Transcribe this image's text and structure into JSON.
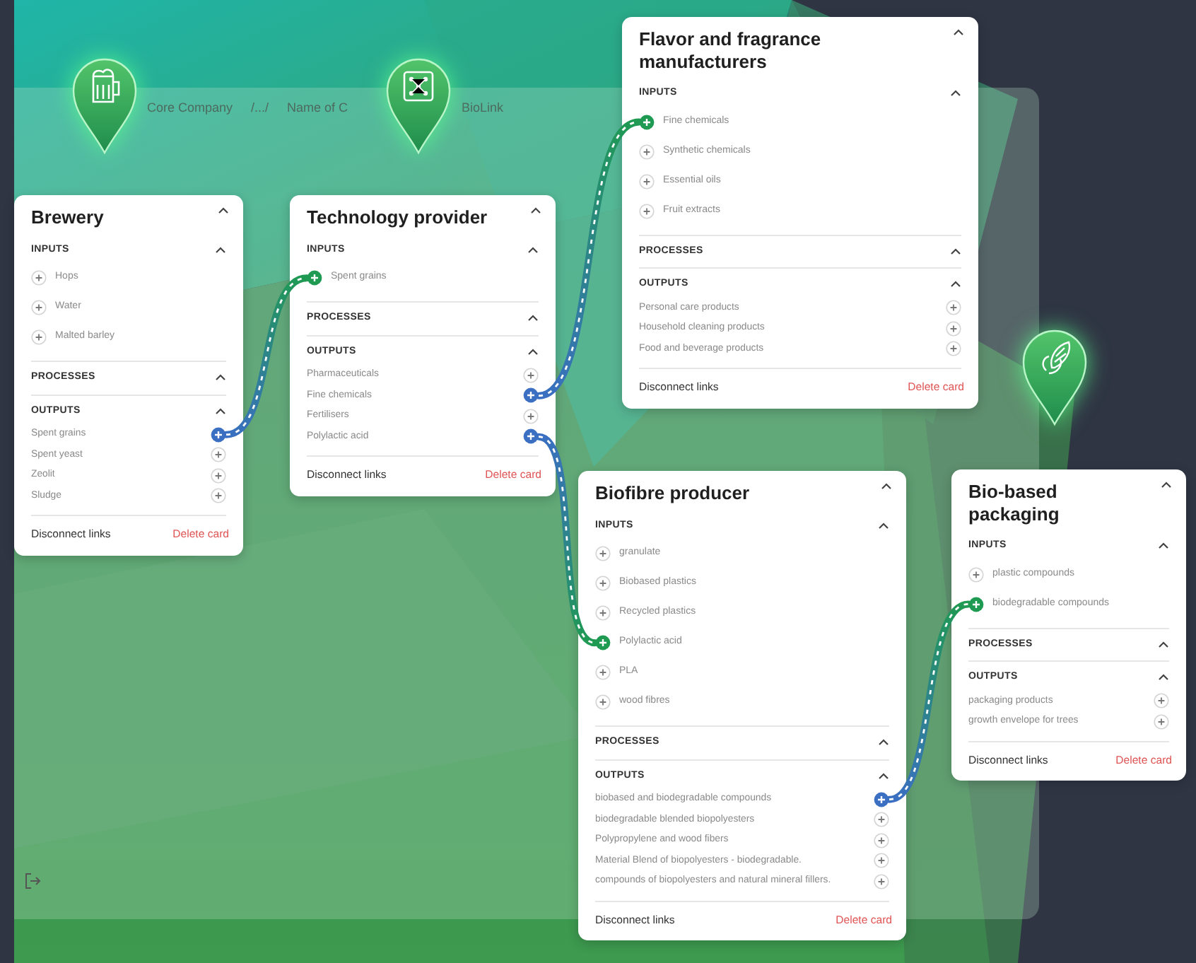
{
  "breadcrumb": [
    "Core Company",
    "/.../",
    "Name of C",
    "BioLink"
  ],
  "cards": [
    {
      "title": "Brewery",
      "expanded": true,
      "sections": [
        {
          "kind": "inputs",
          "title": "INPUTS",
          "expanded": true,
          "items": [
            {
              "label": "Hops",
              "linked": false
            },
            {
              "label": "Water",
              "linked": false
            },
            {
              "label": "Malted barley",
              "linked": false
            }
          ]
        },
        {
          "kind": "processes",
          "title": "PROCESSES",
          "expanded": true
        },
        {
          "kind": "outputs",
          "title": "OUTPUTS",
          "expanded": true,
          "items": [
            {
              "label": "Spent grains",
              "linked": true
            },
            {
              "label": "Spent yeast",
              "linked": false
            },
            {
              "label": "Zeolit",
              "linked": false
            },
            {
              "label": "Sludge",
              "linked": false
            }
          ]
        }
      ],
      "disconnect": "Disconnect links",
      "delete": "Delete card"
    },
    {
      "title": "Technology provider",
      "expanded": true,
      "sections": [
        {
          "kind": "inputs",
          "title": "INPUTS",
          "expanded": true,
          "items": [
            {
              "label": "Spent grains",
              "linked": true
            }
          ]
        },
        {
          "kind": "processes",
          "title": "PROCESSES",
          "expanded": true
        },
        {
          "kind": "outputs",
          "title": "OUTPUTS",
          "expanded": true,
          "items": [
            {
              "label": "Pharmaceuticals",
              "linked": false
            },
            {
              "label": "Fine chemicals",
              "linked": true
            },
            {
              "label": "Fertilisers",
              "linked": false
            },
            {
              "label": "Polylactic acid",
              "linked": true
            }
          ]
        }
      ],
      "disconnect": "Disconnect links",
      "delete": "Delete card"
    },
    {
      "title": "Flavor and fragrance manufacturers",
      "expanded": true,
      "sections": [
        {
          "kind": "inputs",
          "title": "INPUTS",
          "expanded": true,
          "items": [
            {
              "label": "Fine chemicals",
              "linked": true
            },
            {
              "label": "Synthetic chemicals",
              "linked": false
            },
            {
              "label": "Essential oils",
              "linked": false
            },
            {
              "label": "Fruit extracts",
              "linked": false
            }
          ]
        },
        {
          "kind": "processes",
          "title": "PROCESSES",
          "expanded": true
        },
        {
          "kind": "outputs",
          "title": "OUTPUTS",
          "expanded": true,
          "items": [
            {
              "label": "Personal care products",
              "linked": false
            },
            {
              "label": "Household cleaning products",
              "linked": false
            },
            {
              "label": "Food and beverage products",
              "linked": false
            }
          ]
        }
      ],
      "disconnect": "Disconnect links",
      "delete": "Delete card"
    },
    {
      "title": "Biofibre producer",
      "expanded": true,
      "sections": [
        {
          "kind": "inputs",
          "title": "INPUTS",
          "expanded": true,
          "items": [
            {
              "label": "granulate",
              "linked": false
            },
            {
              "label": "Biobased plastics",
              "linked": false
            },
            {
              "label": "Recycled plastics",
              "linked": false
            },
            {
              "label": "Polylactic acid",
              "linked": true
            },
            {
              "label": "PLA",
              "linked": false
            },
            {
              "label": "wood fibres",
              "linked": false
            }
          ]
        },
        {
          "kind": "processes",
          "title": "PROCESSES",
          "expanded": true
        },
        {
          "kind": "outputs",
          "title": "OUTPUTS",
          "expanded": true,
          "items": [
            {
              "label": "biobased and biodegradable compounds",
              "linked": true
            },
            {
              "label": "biodegradable blended biopolyesters",
              "linked": false
            },
            {
              "label": "Polypropylene and wood fibers",
              "linked": false
            },
            {
              "label": "Material Blend of biopolyesters - biodegradable.",
              "linked": false
            },
            {
              "label": "compounds of biopolyesters and natural mineral fillers.",
              "linked": false
            }
          ]
        }
      ],
      "disconnect": "Disconnect links",
      "delete": "Delete card"
    },
    {
      "title": "Bio-based packaging",
      "expanded": true,
      "sections": [
        {
          "kind": "inputs",
          "title": "INPUTS",
          "expanded": true,
          "items": [
            {
              "label": "plastic compounds",
              "linked": false
            },
            {
              "label": "biodegradable compounds",
              "linked": true
            }
          ]
        },
        {
          "kind": "processes",
          "title": "PROCESSES",
          "expanded": true
        },
        {
          "kind": "outputs",
          "title": "OUTPUTS",
          "expanded": true,
          "items": [
            {
              "label": "packaging products",
              "linked": false
            },
            {
              "label": "growth envelope for trees",
              "linked": false
            }
          ]
        }
      ],
      "disconnect": "Disconnect links",
      "delete": "Delete card"
    }
  ]
}
